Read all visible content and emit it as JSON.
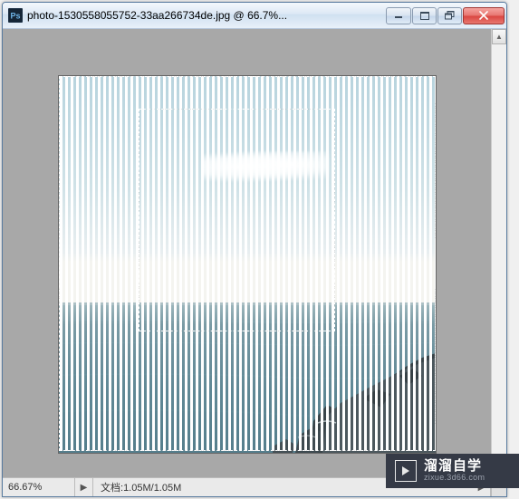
{
  "window": {
    "title": "photo-1530558055752-33aa266734de.jpg @ 66.7%..."
  },
  "status": {
    "zoom": "66.67%",
    "doc_label": "文档:",
    "doc_size": "1.05M/1.05M"
  },
  "watermark": {
    "brand": "溜溜自学",
    "url": "zixue.3d66.com"
  },
  "icons": {
    "app": "Ps"
  }
}
